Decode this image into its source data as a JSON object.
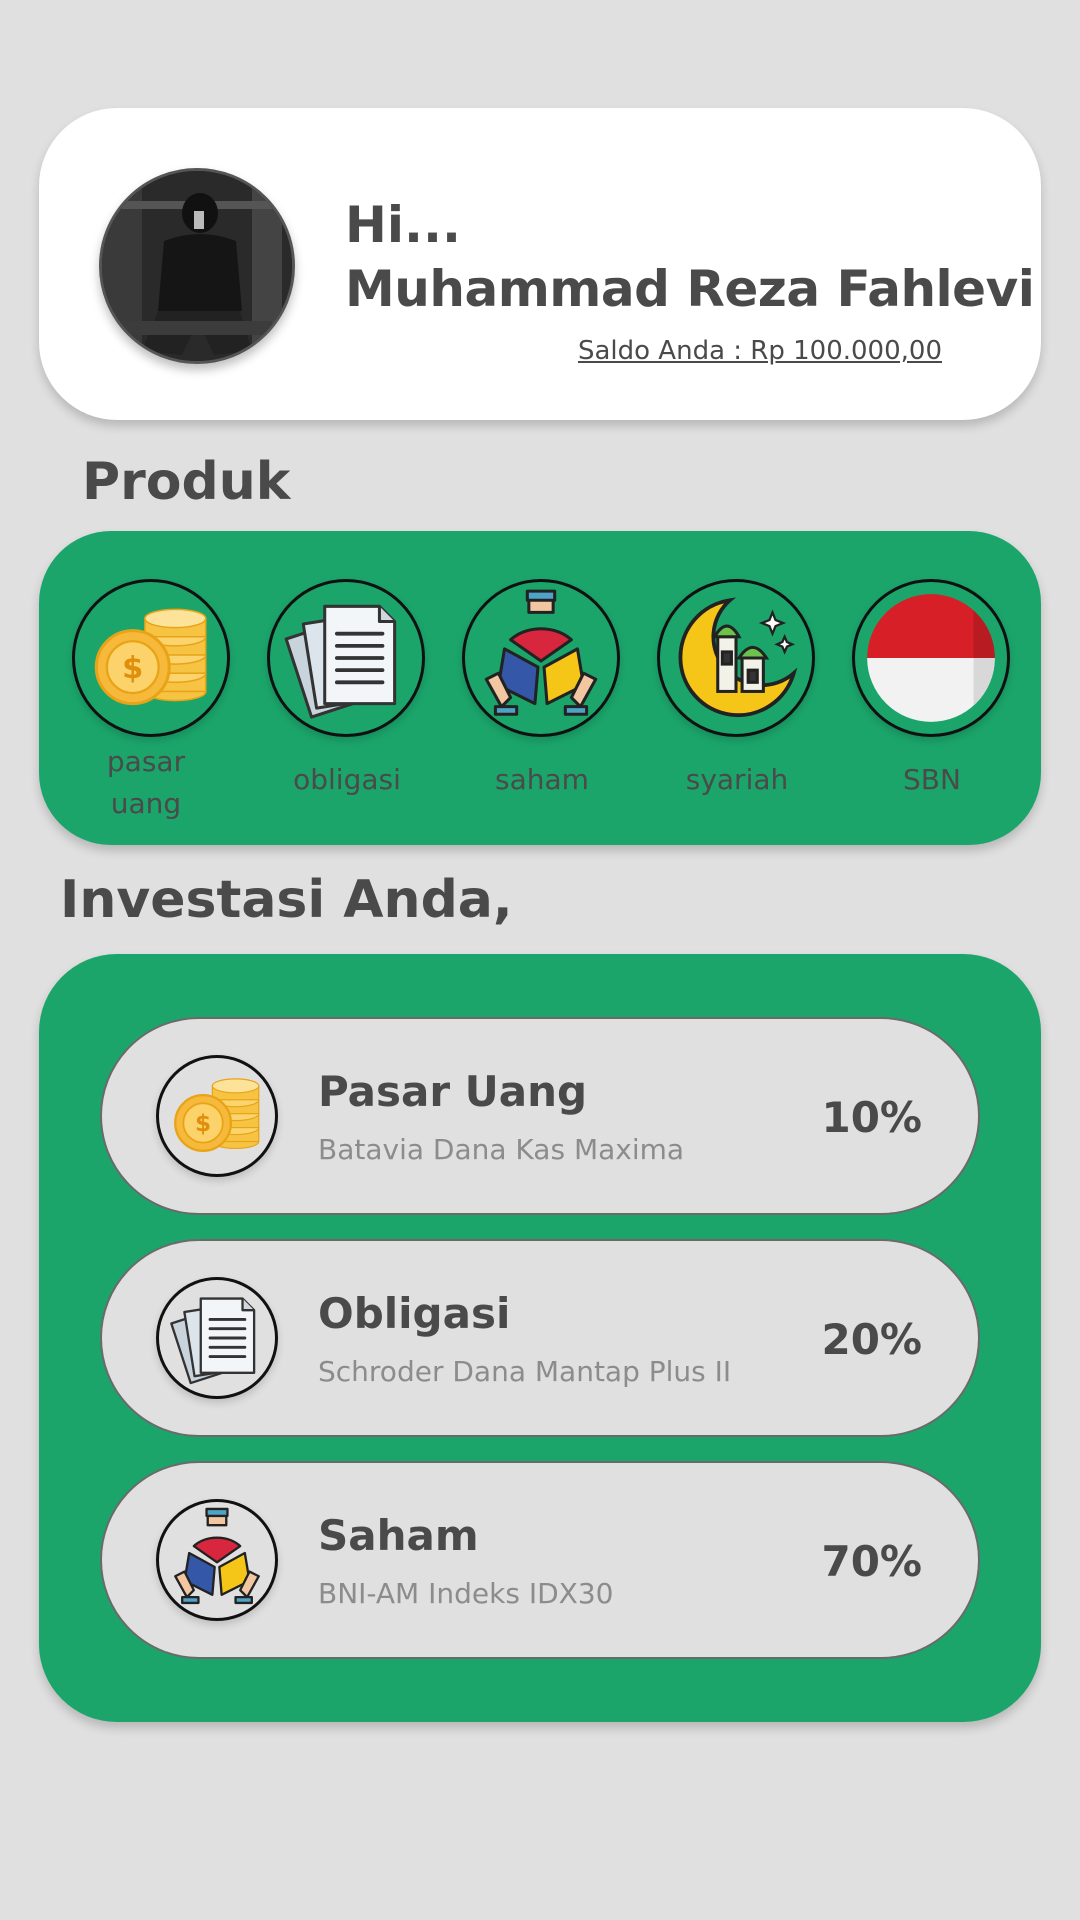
{
  "profile": {
    "greeting": "Hi...",
    "name": "Muhammad Reza Fahlevi",
    "balance": "Saldo Anda : Rp 100.000,00"
  },
  "products": {
    "title": "Produk",
    "items": [
      {
        "label": "pasar\nuang",
        "icon": "coins-icon"
      },
      {
        "label": "obligasi",
        "icon": "documents-icon"
      },
      {
        "label": "saham",
        "icon": "shares-icon"
      },
      {
        "label": "syariah",
        "icon": "crescent-mosque-icon"
      },
      {
        "label": "SBN",
        "icon": "indonesia-flag-icon"
      }
    ]
  },
  "investments": {
    "title": "Investasi Anda,",
    "items": [
      {
        "title": "Pasar Uang",
        "fund": "Batavia Dana Kas Maxima",
        "percent": "10%",
        "icon": "coins-icon"
      },
      {
        "title": "Obligasi",
        "fund": "Schroder Dana Mantap Plus II",
        "percent": "20%",
        "icon": "documents-icon"
      },
      {
        "title": "Saham",
        "fund": "BNI-AM Indeks IDX30",
        "percent": "70%",
        "icon": "shares-icon"
      }
    ]
  },
  "colors": {
    "background": "#e0e0e0",
    "accent_green": "#1ba56b",
    "text_dark": "#4a4a4a",
    "text_muted": "#8c8c8c"
  }
}
